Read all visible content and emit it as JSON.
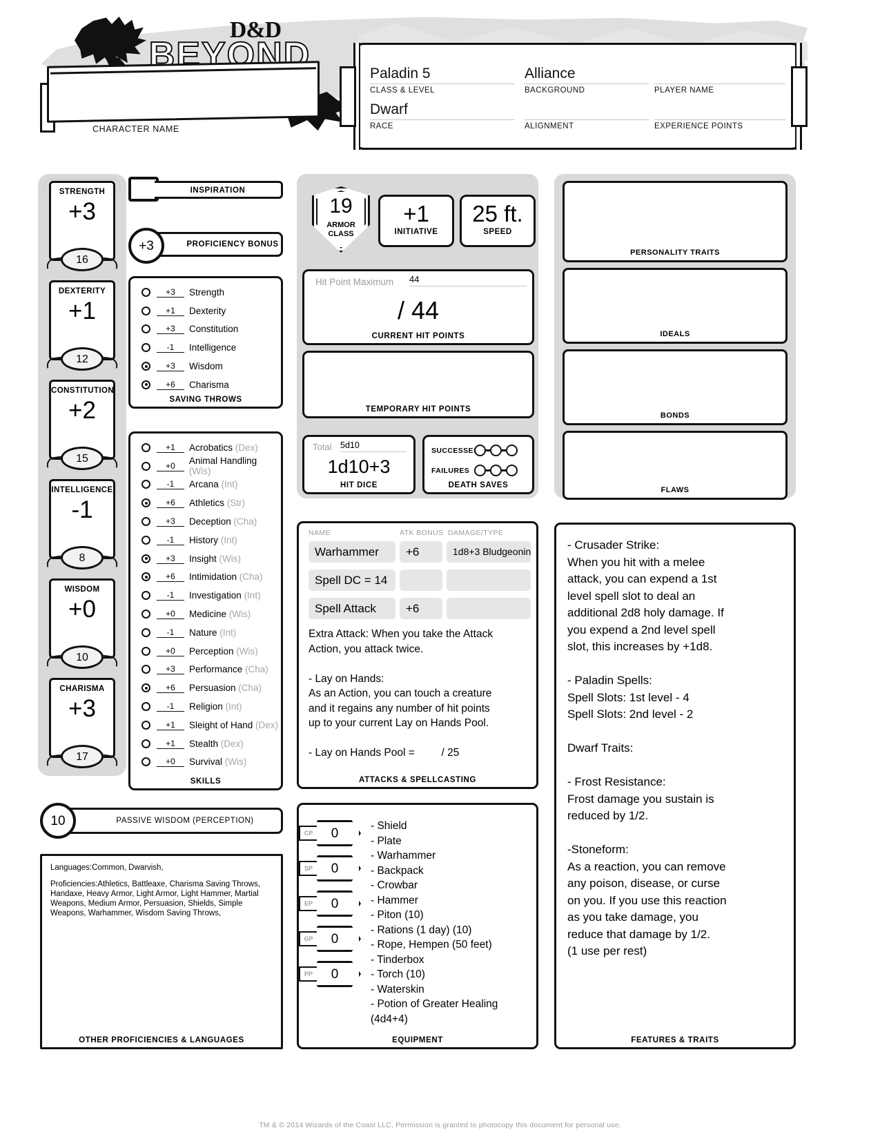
{
  "brand": {
    "dd_logo": "D&D",
    "beyond": "BEYOND",
    "character_name_label": "CHARACTER NAME",
    "character_name_value": ""
  },
  "header": {
    "class_level": {
      "value": "Paladin 5",
      "label": "CLASS & LEVEL"
    },
    "background": {
      "value": "Alliance",
      "label": "BACKGROUND"
    },
    "player_name": {
      "value": "",
      "label": "PLAYER NAME"
    },
    "race": {
      "value": "Dwarf",
      "label": "RACE"
    },
    "alignment": {
      "value": "",
      "label": "ALIGNMENT"
    },
    "experience_points": {
      "value": "",
      "label": "EXPERIENCE POINTS"
    }
  },
  "abilities": [
    {
      "name": "STRENGTH",
      "mod": "+3",
      "score": "16"
    },
    {
      "name": "DEXTERITY",
      "mod": "+1",
      "score": "12"
    },
    {
      "name": "CONSTITUTION",
      "mod": "+2",
      "score": "15"
    },
    {
      "name": "INTELLIGENCE",
      "mod": "-1",
      "score": "8"
    },
    {
      "name": "WISDOM",
      "mod": "+0",
      "score": "10"
    },
    {
      "name": "CHARISMA",
      "mod": "+3",
      "score": "17"
    }
  ],
  "inspiration": {
    "label": "INSPIRATION",
    "value": ""
  },
  "proficiency_bonus": {
    "label": "PROFICIENCY BONUS",
    "value": "+3"
  },
  "saving_throws": {
    "caption": "SAVING THROWS",
    "items": [
      {
        "name": "Strength",
        "value": "+3",
        "proficient": false
      },
      {
        "name": "Dexterity",
        "value": "+1",
        "proficient": false
      },
      {
        "name": "Constitution",
        "value": "+3",
        "proficient": false
      },
      {
        "name": "Intelligence",
        "value": "-1",
        "proficient": false
      },
      {
        "name": "Wisdom",
        "value": "+3",
        "proficient": true
      },
      {
        "name": "Charisma",
        "value": "+6",
        "proficient": true
      }
    ]
  },
  "skills": {
    "caption": "SKILLS",
    "items": [
      {
        "name": "Acrobatics",
        "abbr": "(Dex)",
        "value": "+1",
        "proficient": false
      },
      {
        "name": "Animal Handling",
        "abbr": "(Wis)",
        "value": "+0",
        "proficient": false
      },
      {
        "name": "Arcana",
        "abbr": "(Int)",
        "value": "-1",
        "proficient": false
      },
      {
        "name": "Athletics",
        "abbr": "(Str)",
        "value": "+6",
        "proficient": true
      },
      {
        "name": "Deception",
        "abbr": "(Cha)",
        "value": "+3",
        "proficient": false
      },
      {
        "name": "History",
        "abbr": "(Int)",
        "value": "-1",
        "proficient": false
      },
      {
        "name": "Insight",
        "abbr": "(Wis)",
        "value": "+3",
        "proficient": true
      },
      {
        "name": "Intimidation",
        "abbr": "(Cha)",
        "value": "+6",
        "proficient": true
      },
      {
        "name": "Investigation",
        "abbr": "(Int)",
        "value": "-1",
        "proficient": false
      },
      {
        "name": "Medicine",
        "abbr": "(Wis)",
        "value": "+0",
        "proficient": false
      },
      {
        "name": "Nature",
        "abbr": "(Int)",
        "value": "-1",
        "proficient": false
      },
      {
        "name": "Perception",
        "abbr": "(Wis)",
        "value": "+0",
        "proficient": false
      },
      {
        "name": "Performance",
        "abbr": "(Cha)",
        "value": "+3",
        "proficient": false
      },
      {
        "name": "Persuasion",
        "abbr": "(Cha)",
        "value": "+6",
        "proficient": true
      },
      {
        "name": "Religion",
        "abbr": "(Int)",
        "value": "-1",
        "proficient": false
      },
      {
        "name": "Sleight of Hand",
        "abbr": "(Dex)",
        "value": "+1",
        "proficient": false
      },
      {
        "name": "Stealth",
        "abbr": "(Dex)",
        "value": "+1",
        "proficient": false
      },
      {
        "name": "Survival",
        "abbr": "(Wis)",
        "value": "+0",
        "proficient": false
      }
    ]
  },
  "combat": {
    "armor_class": {
      "value": "19",
      "label_line1": "ARMOR",
      "label_line2": "CLASS"
    },
    "initiative": {
      "value": "+1",
      "label": "INITIATIVE"
    },
    "speed": {
      "value": "25 ft.",
      "label": "SPEED"
    },
    "hit_points": {
      "max_label": "Hit Point Maximum",
      "max_value": "44",
      "current": "/ 44",
      "caption": "CURRENT HIT POINTS"
    },
    "temporary_hit_points": {
      "value": "",
      "caption": "TEMPORARY HIT POINTS"
    },
    "hit_dice": {
      "total_label": "Total",
      "total_value": "5d10",
      "value": "1d10+3",
      "caption": "HIT DICE"
    },
    "death_saves": {
      "caption": "DEATH SAVES",
      "successes_label": "SUCCESSES",
      "failures_label": "FAILURES",
      "successes": [
        false,
        false,
        false
      ],
      "failures": [
        false,
        false,
        false
      ]
    }
  },
  "attacks": {
    "caption": "ATTACKS & SPELLCASTING",
    "columns": [
      "NAME",
      "ATK BONUS",
      "DAMAGE/TYPE"
    ],
    "rows": [
      {
        "name": "Warhammer",
        "atk": "+6",
        "damage": "1d8+3 Bludgeoning"
      },
      {
        "name": "Spell DC = 14",
        "atk": "",
        "damage": ""
      },
      {
        "name": "Spell Attack",
        "atk": "+6",
        "damage": ""
      }
    ],
    "notes": "Extra Attack: When you take the Attack\nAction, you attack twice.\n\n- Lay on Hands:\nAs an Action, you can touch a creature\nand it regains any number of hit points\nup to your current Lay on Hands Pool.\n\n- Lay on Hands Pool =         / 25"
  },
  "equipment": {
    "caption": "EQUIPMENT",
    "coins": [
      {
        "tag": "CP",
        "value": "0"
      },
      {
        "tag": "SP",
        "value": "0"
      },
      {
        "tag": "EP",
        "value": "0"
      },
      {
        "tag": "GP",
        "value": "0"
      },
      {
        "tag": "PP",
        "value": "0"
      }
    ],
    "items": [
      "- Shield",
      "- Plate",
      "- Warhammer",
      "- Backpack",
      "- Crowbar",
      "- Hammer",
      "- Piton (10)",
      "- Rations (1 day) (10)",
      "- Rope, Hempen (50 feet)",
      "- Tinderbox",
      "- Torch (10)",
      "- Waterskin",
      "- Potion of Greater Healing",
      "(4d4+4)"
    ]
  },
  "passive_wisdom": {
    "value": "10",
    "label": "PASSIVE WISDOM (PERCEPTION)"
  },
  "other_proficiencies": {
    "caption": "OTHER PROFICIENCIES & LANGUAGES",
    "languages": "Languages:Common, Dwarvish,",
    "proficiencies": "Proficiencies:Athletics, Battleaxe, Charisma Saving Throws, Handaxe, Heavy Armor, Light Armor, Light Hammer, Martial Weapons, Medium Armor, Persuasion, Shields, Simple Weapons, Warhammer, Wisdom Saving Throws,"
  },
  "personality": {
    "traits": {
      "caption": "PERSONALITY TRAITS",
      "value": ""
    },
    "ideals": {
      "caption": "IDEALS",
      "value": ""
    },
    "bonds": {
      "caption": "BONDS",
      "value": ""
    },
    "flaws": {
      "caption": "FLAWS",
      "value": ""
    }
  },
  "features": {
    "caption": "FEATURES & TRAITS",
    "text": "- Crusader Strike:\nWhen you hit with a melee\nattack, you can expend a 1st\nlevel spell slot to deal an\nadditional 2d8 holy damage. If\nyou expend a 2nd level spell\nslot, this increases by +1d8.\n\n- Paladin Spells:\nSpell Slots: 1st level - 4\nSpell Slots: 2nd level - 2\n\nDwarf Traits:\n\n- Frost Resistance:\nFrost damage you sustain is\nreduced by 1/2.\n\n-Stoneform:\nAs a reaction, you can remove\nany poison, disease, or curse\non you. If you use this reaction\nas you take damage, you\nreduce that damage by 1/2.\n(1 use per rest)"
  },
  "footer": "TM & © 2014 Wizards of the Coast LLC. Permission is granted to photocopy this document for personal use."
}
